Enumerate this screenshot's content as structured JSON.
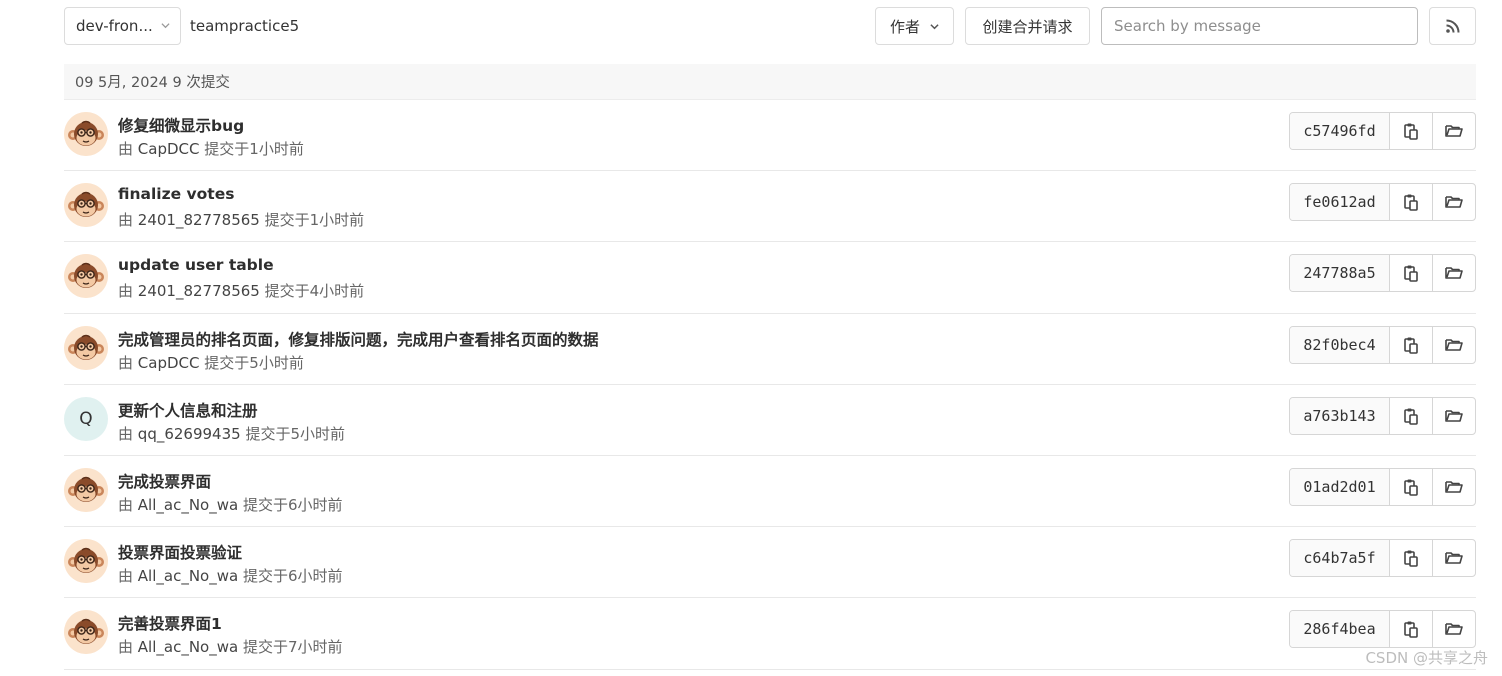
{
  "topbar": {
    "branch_label": "dev-fron...",
    "path_label": "teampractice5",
    "author_label": "作者",
    "create_mr_label": "创建合并请求",
    "search_placeholder": "Search by message"
  },
  "day_header": "09 5月, 2024 9 次提交",
  "commits": [
    {
      "title": "修复细微显示bug",
      "by": "由",
      "author": "CapDCC",
      "committed": "提交于",
      "time": "1小时前",
      "sha": "c57496fd",
      "avatar": "monkey"
    },
    {
      "title": "finalize votes",
      "by": "由",
      "author": "2401_82778565",
      "committed": "提交于",
      "time": "1小时前",
      "sha": "fe0612ad",
      "avatar": "monkey"
    },
    {
      "title": "update user table",
      "by": "由",
      "author": "2401_82778565",
      "committed": "提交于",
      "time": "4小时前",
      "sha": "247788a5",
      "avatar": "monkey"
    },
    {
      "title": "完成管理员的排名页面，修复排版问题，完成用户查看排名页面的数据",
      "by": "由",
      "author": "CapDCC",
      "committed": "提交于",
      "time": "5小时前",
      "sha": "82f0bec4",
      "avatar": "monkey"
    },
    {
      "title": "更新个人信息和注册",
      "by": "由",
      "author": "qq_62699435",
      "committed": "提交于",
      "time": "5小时前",
      "sha": "a763b143",
      "avatar": "Q"
    },
    {
      "title": "完成投票界面",
      "by": "由",
      "author": "All_ac_No_wa",
      "committed": "提交于",
      "time": "6小时前",
      "sha": "01ad2d01",
      "avatar": "monkey"
    },
    {
      "title": "投票界面投票验证",
      "by": "由",
      "author": "All_ac_No_wa",
      "committed": "提交于",
      "time": "6小时前",
      "sha": "c64b7a5f",
      "avatar": "monkey"
    },
    {
      "title": "完善投票界面1",
      "by": "由",
      "author": "All_ac_No_wa",
      "committed": "提交于",
      "time": "7小时前",
      "sha": "286f4bea",
      "avatar": "monkey"
    }
  ],
  "watermark": "CSDN @共享之舟"
}
